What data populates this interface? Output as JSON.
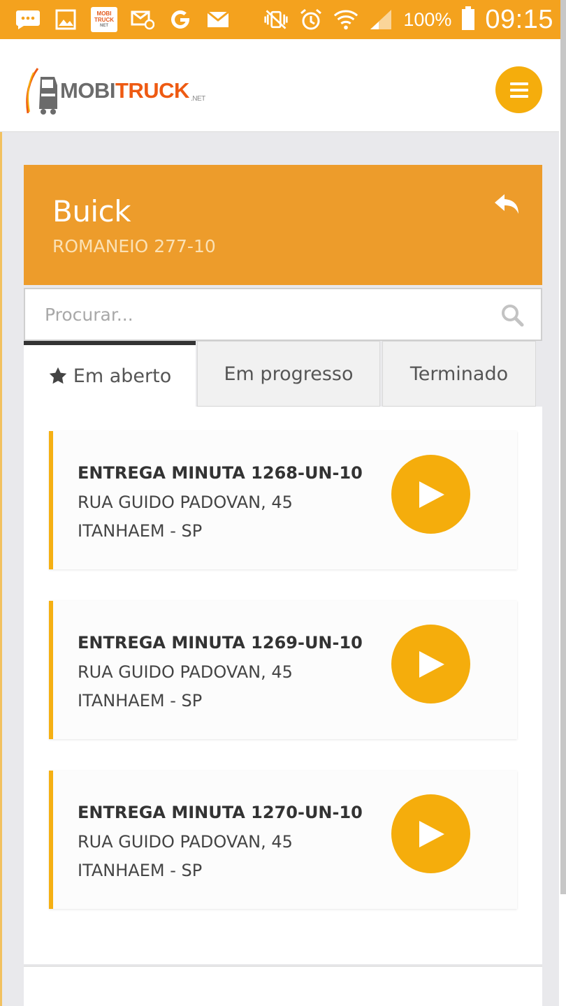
{
  "status_bar": {
    "battery": "100%",
    "time": "09:15",
    "mini_logo_lines": [
      "MOBI",
      "TRUCK",
      "NET"
    ],
    "icons": [
      "chat-icon",
      "image-icon",
      "mobitruck-app-icon",
      "email-at-icon",
      "google-icon",
      "mail-icon",
      "vibrate-off-icon",
      "alarm-icon",
      "wifi-icon",
      "signal-icon",
      "battery-icon"
    ]
  },
  "header": {
    "logo": {
      "mobi": "MOBI",
      "truck": "TRUCK",
      "net": ".NET"
    },
    "menu_icon": "hamburger-icon"
  },
  "panel": {
    "title": "Buick",
    "subtitle": "ROMANEIO 277-10",
    "back_icon": "reply-icon"
  },
  "search": {
    "placeholder": "Procurar...",
    "value": "",
    "icon": "search-icon"
  },
  "tabs": [
    {
      "label": "Em aberto",
      "active": true,
      "icon": "star-icon"
    },
    {
      "label": "Em progresso",
      "active": false
    },
    {
      "label": "Terminado",
      "active": false
    }
  ],
  "items": [
    {
      "title": "ENTREGA MINUTA 1268-UN-10",
      "address": "RUA GUIDO PADOVAN, 45",
      "city": "ITANHAEM - SP"
    },
    {
      "title": "ENTREGA MINUTA 1269-UN-10",
      "address": "RUA GUIDO PADOVAN, 45",
      "city": "ITANHAEM - SP"
    },
    {
      "title": "ENTREGA MINUTA 1270-UN-10",
      "address": "RUA GUIDO PADOVAN, 45",
      "city": "ITANHAEM - SP"
    }
  ],
  "colors": {
    "status_bar": "#f4a21e",
    "panel_header": "#ed9c2b",
    "accent_yellow": "#f5ad0c",
    "logo_orange": "#ee5a12",
    "logo_gray": "#6b6b6b"
  }
}
